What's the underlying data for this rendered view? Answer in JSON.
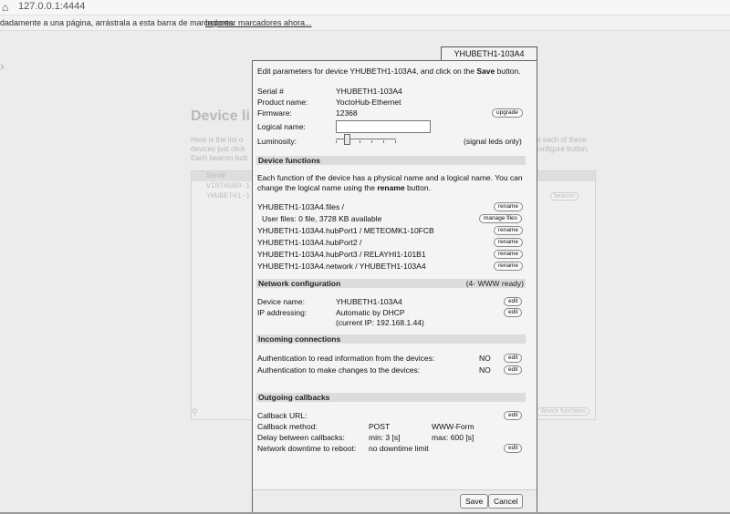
{
  "browser": {
    "url": "127.0.0.1:4444",
    "bookmarks_hint": "dadamente a una página, arrástrala a esta barra de marcadores.",
    "bookmarks_link": "Importar marcadores ahora..."
  },
  "background": {
    "title": "Device li",
    "text_left": "Here is the list o devices just click Each beacon butt",
    "text_right": "ut each of these configure button.",
    "table_header": "Serial",
    "rows": [
      "VIRTHUB0-1",
      "YHUBETH1-1"
    ],
    "btn_beacon": "beacon",
    "btn_device_functions": "device functions"
  },
  "dialog": {
    "tab_label": "YHUBETH1-103A4",
    "intro_prefix": "Edit parameters for device YHUBETH1-103A4, and click on the ",
    "intro_bold": "Save",
    "intro_suffix": " button.",
    "serial_label": "Serial #",
    "serial_value": "YHUBETH1-103A4",
    "product_label": "Product name:",
    "product_value": "YoctoHub-Ethernet",
    "firmware_label": "Firmware:",
    "firmware_value": "12368",
    "upgrade_btn": "upgrade",
    "logical_label": "Logical name:",
    "logical_value": "",
    "luminosity_label": "Luminosity:",
    "luminosity_hint": "(signal leds only)",
    "luminosity_level": 0.15,
    "functions_title": "Device functions",
    "functions_text_1": "Each function of the device has a physical name and a logical name. You can",
    "functions_text_2_prefix": "change the logical name using the ",
    "functions_text_2_bold": "rename",
    "functions_text_2_suffix": " button.",
    "functions": [
      {
        "name": "YHUBETH1-103A4.files /",
        "btn": "rename"
      },
      {
        "name": "User files: 0 file, 3728 KB available",
        "btn": "manage files"
      },
      {
        "name": "YHUBETH1-103A4.hubPort1 / METEOMK1-10FCB",
        "btn": "rename"
      },
      {
        "name": "YHUBETH1-103A4.hubPort2 /",
        "btn": "rename"
      },
      {
        "name": "YHUBETH1-103A4.hubPort3 / RELAYHI1-101B1",
        "btn": "rename"
      },
      {
        "name": "YHUBETH1-103A4.network / YHUBETH1-103A4",
        "btn": "rename"
      }
    ],
    "network_title": "Network configuration",
    "network_status": "(4- WWW ready)",
    "device_name_label": "Device name:",
    "device_name_value": "YHUBETH1-103A4",
    "ip_label": "IP addressing:",
    "ip_value": "Automatic by DHCP",
    "ip_current": "(current IP: 192.168.1.44)",
    "edit_btn": "edit",
    "incoming_title": "Incoming connections",
    "auth_read_label": "Authentication to read information from the devices:",
    "auth_read_value": "NO",
    "auth_change_label": "Authentication to make changes to the devices:",
    "auth_change_value": "NO",
    "outgoing_title": "Outgoing callbacks",
    "callback_url_label": "Callback URL:",
    "callback_method_label": "Callback method:",
    "callback_method_value": "POST",
    "callback_format_value": "WWW-Form",
    "delay_label": "Delay between callbacks:",
    "delay_min": "min: 3 [s]",
    "delay_max": "max: 600 [s]",
    "downtime_label": "Network downtime to reboot:",
    "downtime_value": "no downtime limit",
    "save_btn": "Save",
    "cancel_btn": "Cancel"
  }
}
